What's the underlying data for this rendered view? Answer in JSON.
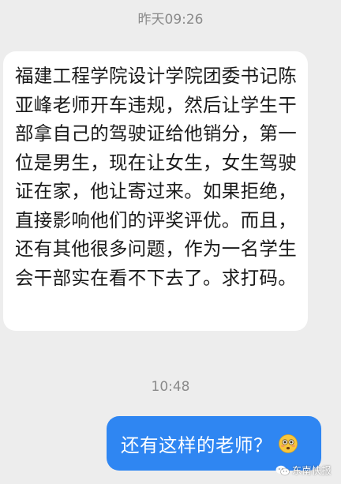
{
  "chat": {
    "timestamp_1": "昨天09:26",
    "incoming_message": "福建工程学院设计学院团委书记陈亚峰老师开车违规，然后让学生干部拿自己的驾驶证给他销分，第一位是男生，现在让女生，女生驾驶证在家，他让寄过来。如果拒绝，直接影响他们的评奖评优。而且，还有其他很多问题，作为一名学生会干部实在看不下去了。求打码。",
    "timestamp_2": "10:48",
    "outgoing_message": "还有这样的老师？",
    "outgoing_emoji": "flushed-face-emoji"
  },
  "watermark": {
    "text": "东南快报",
    "icon": "wechat-icon"
  },
  "colors": {
    "background": "#ededed",
    "incoming_bubble": "#ffffff",
    "outgoing_bubble": "#2f86f2",
    "timestamp_text": "#8a8a8a"
  }
}
